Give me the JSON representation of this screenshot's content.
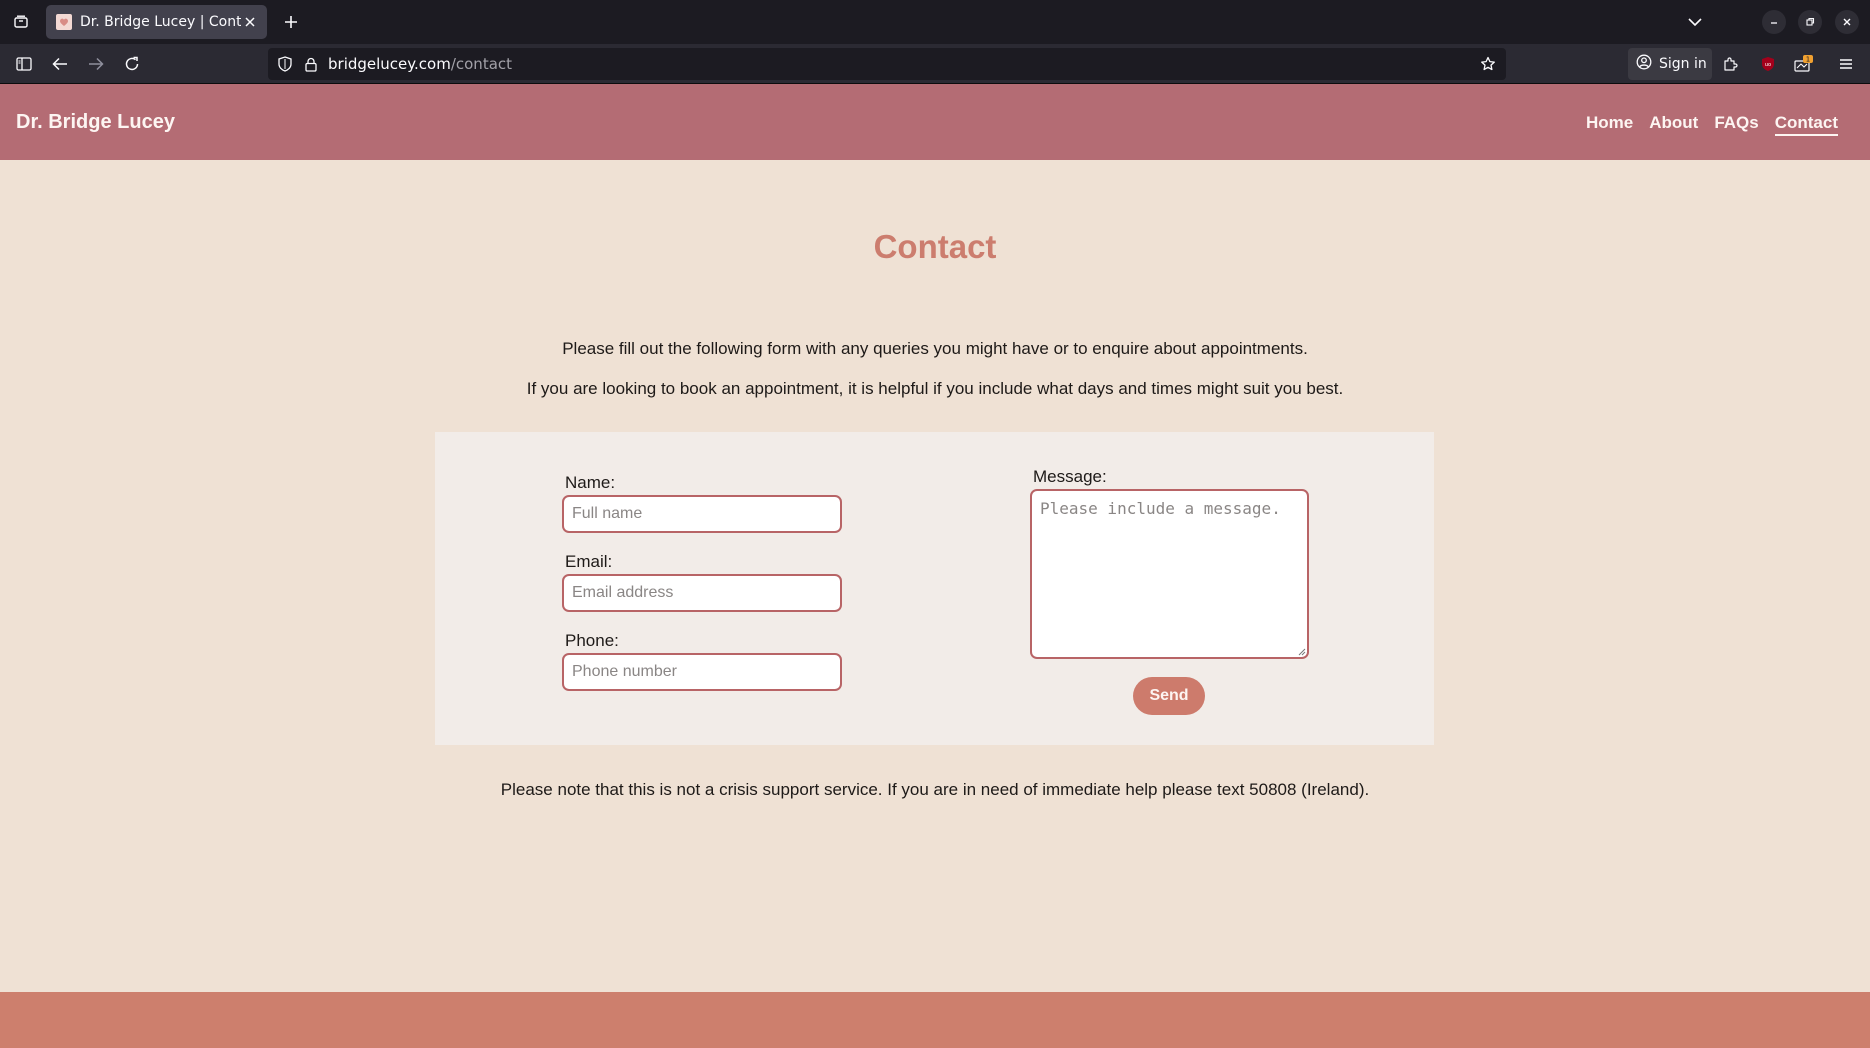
{
  "browser": {
    "tab_title": "Dr. Bridge Lucey | Contact",
    "url_host": "bridgelucey.com",
    "url_path": "/contact",
    "sign_in_label": "Sign in",
    "extension_badge": "1"
  },
  "site": {
    "brand": "Dr. Bridge Lucey",
    "nav": [
      {
        "label": "Home"
      },
      {
        "label": "About"
      },
      {
        "label": "FAQs"
      },
      {
        "label": "Contact",
        "active": true
      }
    ],
    "page_title": "Contact",
    "intro_1": "Please fill out the following form with any queries you might have or to enquire about appointments.",
    "intro_2": "If you are looking to book an appointment, it is helpful if you include what days and times might suit you best.",
    "form": {
      "name_label": "Name:",
      "name_placeholder": "Full name",
      "name_value": "",
      "email_label": "Email:",
      "email_placeholder": "Email address",
      "email_value": "",
      "phone_label": "Phone:",
      "phone_placeholder": "Phone number",
      "phone_value": "",
      "message_label": "Message:",
      "message_placeholder": "Please include a message.",
      "message_value": "",
      "send_label": "Send"
    },
    "footer_note": "Please note that this is not a crisis support service. If you are in need of immediate help please text 50808 (Ireland)."
  },
  "colors": {
    "header_bg": "#b46c74",
    "accent": "#cd7b6c",
    "page_bg": "#efe1d4",
    "card_bg": "#f2ece8",
    "field_border": "#b86466"
  }
}
